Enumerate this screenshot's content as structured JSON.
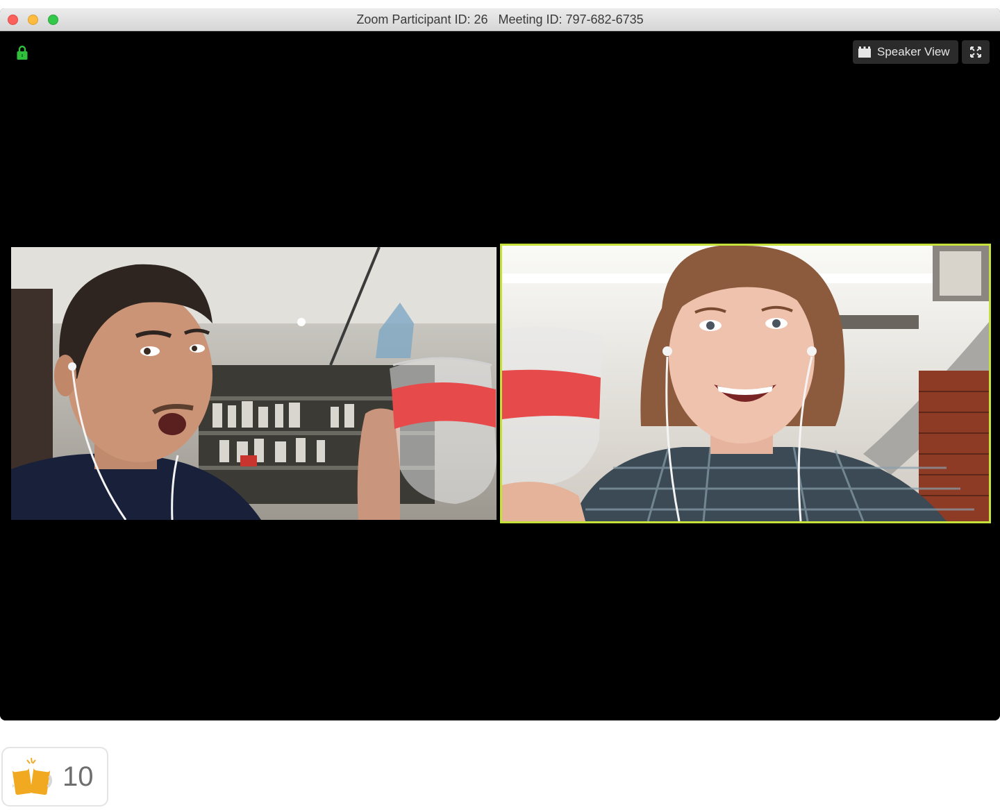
{
  "window": {
    "title": "Zoom Participant ID: 26   Meeting ID: 797-682-6735"
  },
  "toolbar": {
    "view_label": "Speaker View",
    "view_icon": "grid-icon",
    "fullscreen_icon": "fullscreen-icon",
    "lock_icon": "lock-icon",
    "lock_color": "#2fbf3a"
  },
  "video": {
    "active_speaker_border_color": "#c6e23a",
    "participants": [
      {
        "role": "participant",
        "active_speaker": false
      },
      {
        "role": "participant",
        "active_speaker": true
      }
    ]
  },
  "reaction": {
    "icon": "clinking-beer-mugs-icon",
    "count": "10"
  }
}
